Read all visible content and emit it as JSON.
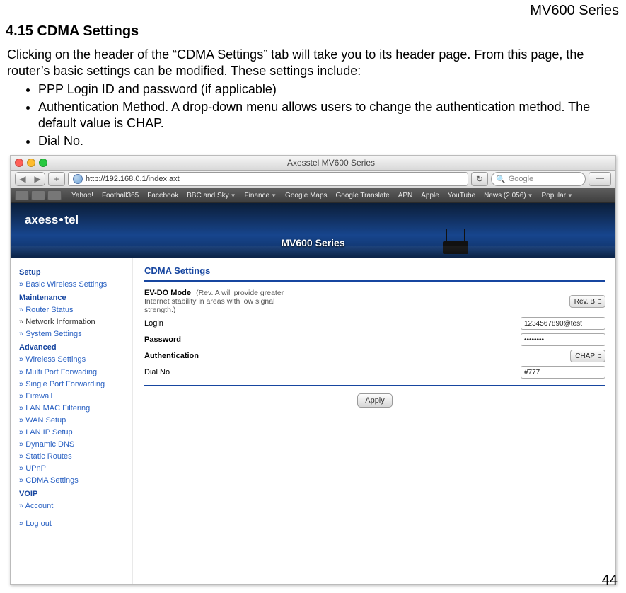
{
  "doc": {
    "running_head": "MV600 Series",
    "section_title": "4.15  CDMA Settings",
    "intro": "Clicking on the header of the “CDMA Settings” tab will take you to its header page. From this page, the router’s basic settings can be modified. These settings include:",
    "bullets": [
      "PPP Login ID and password (if applicable)",
      "Authentication Method. A drop-down menu allows users to change the authentication method. The default value is CHAP.",
      "Dial No."
    ],
    "page_number": "44"
  },
  "browser": {
    "window_title": "Axesstel MV600 Series",
    "url": "http://192.168.0.1/index.axt",
    "reload_glyph": "↻",
    "search_placeholder": "Google",
    "plus_glyph": "+",
    "back_glyph": "◀",
    "fwd_glyph": "▶",
    "bookmarks": [
      "Yahoo!",
      "Football365",
      "Facebook",
      "BBC and Sky",
      "Finance",
      "Google Maps",
      "Google Translate",
      "APN",
      "Apple",
      "YouTube",
      "News (2,056)",
      "Popular"
    ]
  },
  "header": {
    "brand_left": "axess",
    "brand_right": "tel",
    "title": "MV600 Series"
  },
  "sidebar": {
    "groups": [
      {
        "head": "Setup",
        "items": [
          {
            "label": "Basic Wireless Settings",
            "link": true
          }
        ]
      },
      {
        "head": "Maintenance",
        "items": [
          {
            "label": "Router Status",
            "link": true
          },
          {
            "label": "Network Information",
            "link": false
          },
          {
            "label": "System Settings",
            "link": true
          }
        ]
      },
      {
        "head": "Advanced",
        "items": [
          {
            "label": "Wireless Settings",
            "link": true
          },
          {
            "label": "Multi Port Forwading",
            "link": true
          },
          {
            "label": "Single Port Forwarding",
            "link": true
          },
          {
            "label": "Firewall",
            "link": true
          },
          {
            "label": "LAN MAC Filtering",
            "link": true
          },
          {
            "label": "WAN Setup",
            "link": true
          },
          {
            "label": "LAN IP Setup",
            "link": true
          },
          {
            "label": "Dynamic DNS",
            "link": true
          },
          {
            "label": "Static Routes",
            "link": true
          },
          {
            "label": "UPnP",
            "link": true
          },
          {
            "label": "CDMA Settings",
            "link": true
          }
        ]
      },
      {
        "head": "VOIP",
        "items": [
          {
            "label": "Account",
            "link": true
          }
        ]
      },
      {
        "head": "",
        "items": [
          {
            "label": "Log out",
            "link": true
          }
        ]
      }
    ]
  },
  "content": {
    "title": "CDMA Settings",
    "evdo_label": "EV-DO Mode",
    "evdo_note": "(Rev. A will provide greater Internet stability in areas with low signal strength.)",
    "evdo_value": "Rev. B",
    "login_label": "Login",
    "login_value": "1234567890@test",
    "password_label": "Password",
    "password_value": "••••••••",
    "auth_label": "Authentication",
    "auth_value": "CHAP",
    "dial_label": "Dial No",
    "dial_value": "#777",
    "apply_label": "Apply"
  }
}
